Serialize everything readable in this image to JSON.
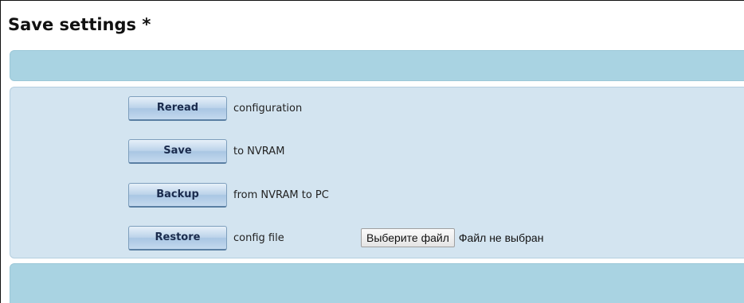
{
  "page": {
    "title": "Save settings *"
  },
  "actions": [
    {
      "button_label": "Reread",
      "description": "configuration"
    },
    {
      "button_label": "Save",
      "description": "to NVRAM"
    },
    {
      "button_label": "Backup",
      "description": "from NVRAM to PC"
    },
    {
      "button_label": "Restore",
      "description": "config file"
    }
  ],
  "file_input": {
    "button_label": "Выберите файл",
    "status": "Файл не выбран"
  },
  "colors": {
    "band": "#a9d3e2",
    "panel": "#d3e4f0",
    "button_top": "#e6f0f9",
    "button_bottom": "#a9c6e3",
    "button_text": "#1a2b4d"
  }
}
